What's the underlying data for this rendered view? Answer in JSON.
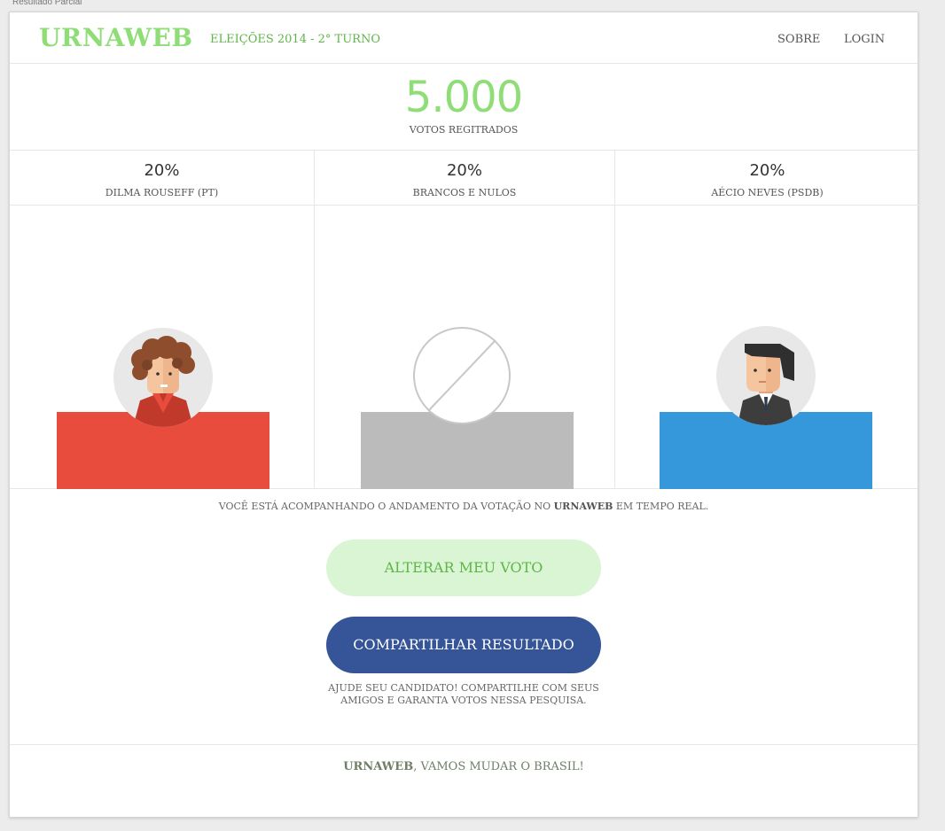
{
  "window": {
    "title": "Resultado Parcial"
  },
  "header": {
    "logo": "URNAWEB",
    "subtitle": "ELEIÇÕES 2014 - 2° TURNO",
    "nav": {
      "sobre": "SOBRE",
      "login": "LOGIN"
    }
  },
  "total": {
    "value": "5.000",
    "label": "VOTOS REGITRADOS"
  },
  "candidates": [
    {
      "percent": "20%",
      "name": "DILMA ROUSEFF (PT)",
      "color": "#e74c3c",
      "bar_fraction": 0.2,
      "avatar": "dilma-avatar-icon"
    },
    {
      "percent": "20%",
      "name": "BRANCOS E NULOS",
      "color": "#bbbbbb",
      "bar_fraction": 0.2,
      "avatar": "null-vote-icon"
    },
    {
      "percent": "20%",
      "name": "AÉCIO NEVES (PSDB)",
      "color": "#3498db",
      "bar_fraction": 0.2,
      "avatar": "aecio-avatar-icon"
    }
  ],
  "info": {
    "before": "VOCÊ ESTÁ ACOMPANHANDO O ANDAMENTO DA VOTAÇÃO NO ",
    "brand": "URNAWEB",
    "after": " EM TEMPO REAL."
  },
  "buttons": {
    "alter": "ALTERAR MEU VOTO",
    "share": "COMPARTILHAR RESULTADO"
  },
  "help": {
    "line1": "AJUDE SEU CANDIDATO! COMPARTILHE COM SEUS",
    "line2": "AMIGOS E GARANTA VOTOS NESSA PESQUISA."
  },
  "footer": {
    "brand": "URNAWEB",
    "text": ", VAMOS MUDAR O BRASIL!"
  },
  "colors": {
    "brand_green": "#8fdd77",
    "dark_green": "#5fb54a",
    "share_blue": "#365498"
  }
}
